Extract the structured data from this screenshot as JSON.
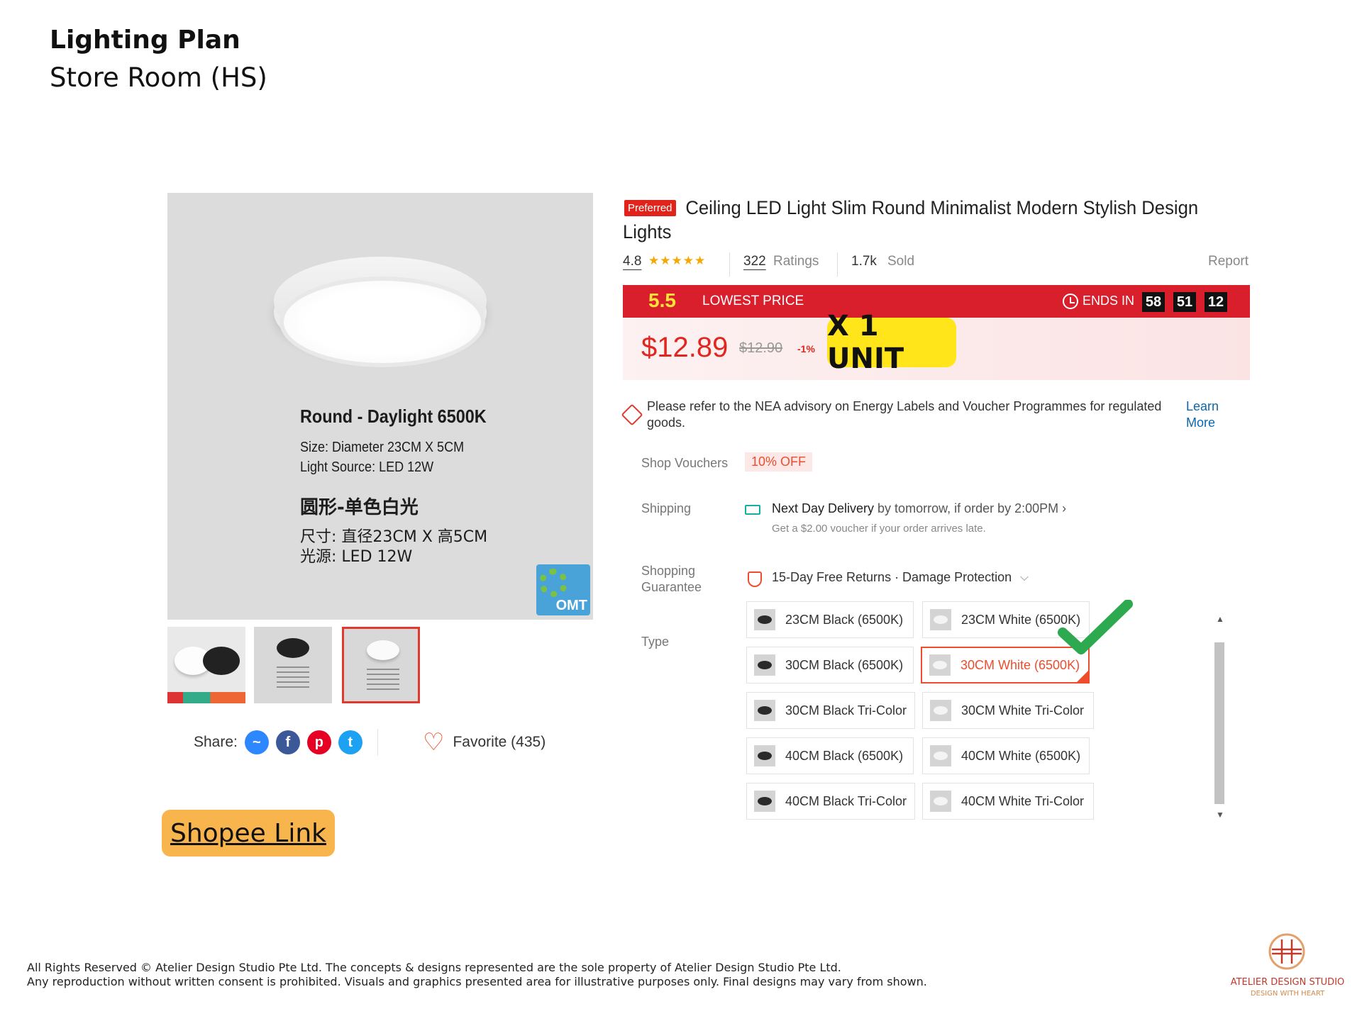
{
  "header": {
    "title": "Lighting Plan",
    "subtitle": "Store Room (HS)"
  },
  "product_image": {
    "title": "Round - Daylight 6500K",
    "size_line": "Size: Diameter 23CM X 5CM",
    "source_line": "Light Source: LED 12W",
    "cn_title": "圆形-单色白光",
    "cn_size_line": "尺寸: 直径23CM X 高5CM",
    "cn_source_line": "光源: LED 12W",
    "watermark": "OMT"
  },
  "thumbnails": [
    {
      "icon": "product-thumbnail-icon",
      "selected": false
    },
    {
      "icon": "product-thumbnail-icon",
      "selected": false
    },
    {
      "icon": "product-thumbnail-icon",
      "selected": true
    }
  ],
  "share": {
    "label": "Share:",
    "icons": [
      "messenger-icon",
      "facebook-icon",
      "pinterest-icon",
      "twitter-icon"
    ]
  },
  "favorite": {
    "label": "Favorite (435)"
  },
  "shopee_link": "Shopee Link",
  "product": {
    "badge": "Preferred",
    "title": "Ceiling LED Light Slim Round Minimalist Modern Stylish Design Lights",
    "rating": "4.8",
    "stars": "★★★★★",
    "ratings_count": "322",
    "ratings_label": "Ratings",
    "sold_count": "1.7k",
    "sold_label": "Sold",
    "report": "Report"
  },
  "flash_sale": {
    "event": "5.5",
    "label": "LOWEST PRICE",
    "ends_label": "ENDS IN",
    "timer": [
      "58",
      "51",
      "12"
    ]
  },
  "price": {
    "current": "$12.89",
    "original": "$12.90",
    "discount": "-1%"
  },
  "annotation": {
    "quantity": "X 1 UNIT"
  },
  "nea": {
    "text": "Please refer to the NEA advisory on Energy Labels and Voucher Programmes for regulated goods.",
    "link": "Learn More"
  },
  "vouchers": {
    "label": "Shop Vouchers",
    "chip": "10% OFF"
  },
  "shipping": {
    "label": "Shipping",
    "main_bold": "Next Day Delivery",
    "main_rest": " by tomorrow, if order by 2:00PM  ›",
    "sub": "Get a $2.00 voucher if your order arrives late."
  },
  "guarantee": {
    "label_line1": "Shopping",
    "label_line2": "Guarantee",
    "text": "15-Day Free Returns · Damage Protection",
    "chevron": "⌵"
  },
  "type": {
    "label": "Type",
    "options": [
      {
        "label": "23CM Black (6500K)",
        "selected": false,
        "shade": "dark"
      },
      {
        "label": "23CM White (6500K)",
        "selected": false,
        "shade": "light"
      },
      {
        "label": "30CM Black (6500K)",
        "selected": false,
        "shade": "dark"
      },
      {
        "label": "30CM White (6500K)",
        "selected": true,
        "shade": "light"
      },
      {
        "label": "30CM Black Tri-Color",
        "selected": false,
        "shade": "dark"
      },
      {
        "label": "30CM White Tri-Color",
        "selected": false,
        "shade": "light"
      },
      {
        "label": "40CM Black (6500K)",
        "selected": false,
        "shade": "dark"
      },
      {
        "label": "40CM White (6500K)",
        "selected": false,
        "shade": "light"
      },
      {
        "label": "40CM Black Tri-Color",
        "selected": false,
        "shade": "dark"
      },
      {
        "label": "40CM White Tri-Color",
        "selected": false,
        "shade": "light"
      }
    ],
    "scroll_up": "▲",
    "scroll_down": "▼"
  },
  "footer": {
    "line1": "All Rights Reserved © Atelier Design Studio Pte Ltd. The concepts & designs represented are the sole property of Atelier Design Studio Pte Ltd.",
    "line2": "Any reproduction without written consent is prohibited. Visuals and graphics presented area for illustrative purposes only. Final designs may vary from shown."
  },
  "brand": {
    "name": "ATELIER DESIGN STUDIO",
    "tagline": "DESIGN WITH HEART"
  },
  "colors": {
    "accent": "#ee4d2d",
    "flash_bar": "#d91f2b",
    "highlight": "#ffe51a",
    "link_button": "#f9b54d",
    "check": "#2daa4f"
  }
}
